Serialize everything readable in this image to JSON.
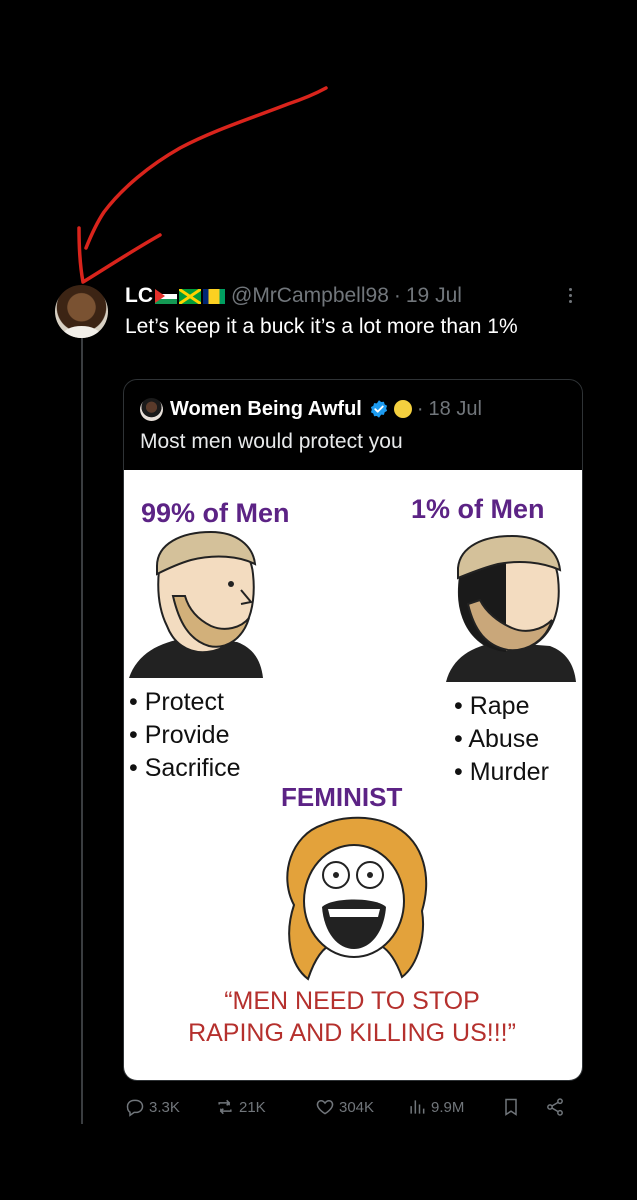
{
  "tweet": {
    "author_name": "LC",
    "flags": [
      "palestine-flag",
      "jamaica-flag",
      "saint-vincent-flag"
    ],
    "handle": "@MrCampbell98",
    "separator": "·",
    "date": "19 Jul",
    "text": "Let’s keep it a buck it’s a lot more than 1%"
  },
  "quoted": {
    "author_name": "Women Being Awful",
    "separator": "·",
    "date": "18 Jul",
    "text": "Most men would protect you",
    "meme": {
      "left_title": "99% of Men",
      "right_title": "1% of Men",
      "left_bullets": [
        "Protect",
        "Provide",
        "Sacrifice"
      ],
      "right_bullets": [
        "Rape",
        "Abuse",
        "Murder"
      ],
      "feminist_label": "FEMINIST",
      "quote": "“MEN NEED TO STOP RAPING AND KILLING US!!!”"
    }
  },
  "actions": {
    "replies": "3.3K",
    "reposts": "21K",
    "likes": "304K",
    "views": "9.9M"
  },
  "colors": {
    "background": "#000000",
    "annotation_arrow": "#d9241c",
    "meme_purple": "#5c2385",
    "meme_red": "#b5302d",
    "muted": "#71767b"
  }
}
